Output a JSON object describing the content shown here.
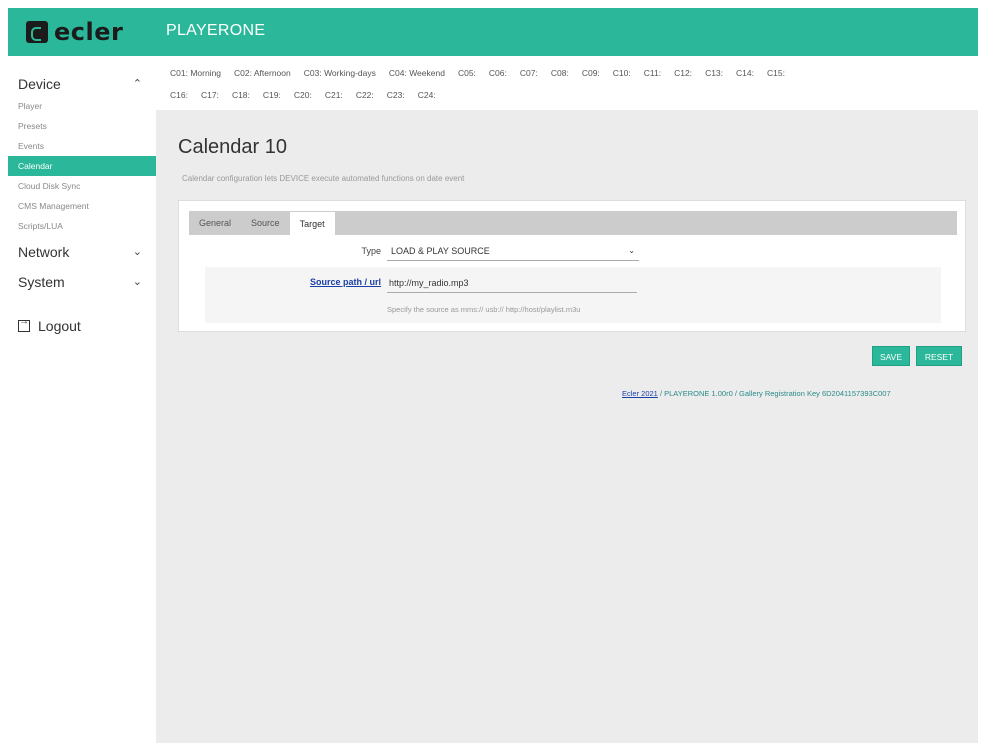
{
  "header": {
    "logo": "ecler",
    "app_title": "PLAYERONE"
  },
  "sidebar": {
    "groups": [
      {
        "label": "Device",
        "items": [
          "Player",
          "Presets",
          "Events",
          "Calendar",
          "Cloud Disk Sync",
          "CMS Management",
          "Scripts/LUA"
        ]
      },
      {
        "label": "Network"
      },
      {
        "label": "System"
      }
    ],
    "active_item": "Calendar",
    "logout": "Logout"
  },
  "calendars": {
    "row1": [
      "C01: Morning",
      "C02: Afternoon",
      "C03: Working-days",
      "C04: Weekend",
      "C05:",
      "C06:",
      "C07:",
      "C08:",
      "C09:",
      "C10:",
      "C11:",
      "C12:",
      "C13:",
      "C14:",
      "C15:"
    ],
    "row2": [
      "C16:",
      "C17:",
      "C18:",
      "C19:",
      "C20:",
      "C21:",
      "C22:",
      "C23:",
      "C24:"
    ]
  },
  "page": {
    "title": "Calendar 10",
    "description": "Calendar configuration lets DEVICE execute automated functions on date event"
  },
  "panel": {
    "tabs": [
      "General",
      "Source",
      "Target"
    ],
    "active_tab": "Target",
    "type_label": "Type",
    "type_value": "LOAD & PLAY SOURCE",
    "source_label": "Source path / url",
    "source_value": "http://my_radio.mp3",
    "source_hint": "Specify the source as mms:// usb:// http://host/playlist.m3u"
  },
  "buttons": {
    "save": "SAVE",
    "reset": "RESET"
  },
  "footer": {
    "link": "Ecler 2021",
    "text": " / PLAYERONE 1.00r0 / Gallery Registration Key 6D2041157393C007"
  },
  "colors": {
    "accent": "#2bb89a",
    "link": "#1a3fa6"
  },
  "icons": {
    "expand": "chevron-up-icon",
    "collapse": "chevron-down-icon",
    "logout": "logout-icon",
    "dropdown": "caret-down-icon"
  }
}
